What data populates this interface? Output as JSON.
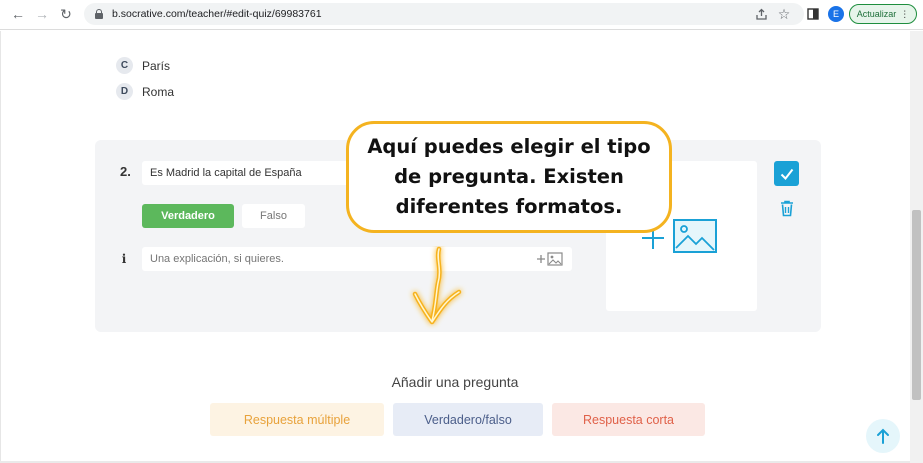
{
  "browser": {
    "url": "b.socrative.com/teacher/#edit-quiz/69983761",
    "profile_initial": "E",
    "update_label": "Actualizar",
    "update_menu_glyph": "⋮",
    "icons": {
      "back": "←",
      "forward": "→",
      "reload": "↻",
      "share": "share-icon",
      "bookmark": "☆",
      "sidepanel": "sidepanel-icon"
    }
  },
  "previous_question": {
    "options": [
      {
        "letter": "C",
        "text": "París"
      },
      {
        "letter": "D",
        "text": "Roma"
      }
    ]
  },
  "question": {
    "number": "2.",
    "text": "Es Madrid la capital de España",
    "true_label": "Verdadero",
    "false_label": "Falso",
    "info_glyph": "i",
    "explanation_placeholder": "Una explicación, si quieres."
  },
  "callout": {
    "text": "Aquí puedes elegir el tipo de pregunta. Existen diferentes formatos.",
    "border_color": "#f4b320"
  },
  "add_question": {
    "title": "Añadir una pregunta",
    "types": [
      "Respuesta múltiple",
      "Verdadero/falso",
      "Respuesta corta"
    ]
  },
  "colors": {
    "true_button": "#5cb85c",
    "check_button": "#1aa1d6",
    "multi": "#e8a23b",
    "truefalse": "#4b5e8a",
    "short": "#e06149"
  }
}
